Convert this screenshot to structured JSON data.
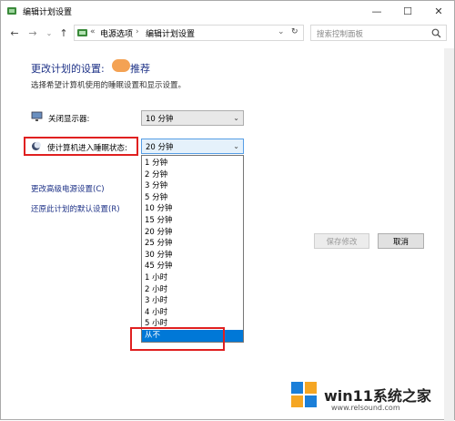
{
  "window": {
    "title": "编辑计划设置",
    "controls": {
      "minimize": "—",
      "maximize": "☐",
      "close": "✕"
    }
  },
  "addressbar": {
    "prefix": "«",
    "crumbs": [
      "电源选项",
      "编辑计划设置"
    ],
    "separator": "›",
    "refresh": "↻",
    "search_placeholder": "搜索控制面板"
  },
  "content": {
    "heading": "更改计划的设置:",
    "heading_suffix": "推荐",
    "subtext": "选择希望计算机使用的睡眠设置和显示设置。",
    "display_off": {
      "label": "关闭显示器:",
      "value": "10 分钟"
    },
    "sleep": {
      "label": "使计算机进入睡眠状态:",
      "value": "20 分钟"
    },
    "links": [
      "更改高级电源设置(C)",
      "还原此计划的默认设置(R)"
    ],
    "buttons": {
      "save": "保存修改",
      "cancel": "取消"
    }
  },
  "sleep_options": [
    "1 分钟",
    "2 分钟",
    "3 分钟",
    "5 分钟",
    "10 分钟",
    "15 分钟",
    "20 分钟",
    "25 分钟",
    "30 分钟",
    "45 分钟",
    "1 小时",
    "2 小时",
    "3 小时",
    "4 小时",
    "5 小时",
    "从不"
  ],
  "selected_option": "从不",
  "watermark": {
    "text": "win11系统之家",
    "url": "www.relsound.com"
  },
  "colors": {
    "accent": "#0078d7",
    "link": "#1e3287",
    "highlight_box": "#e02020"
  }
}
